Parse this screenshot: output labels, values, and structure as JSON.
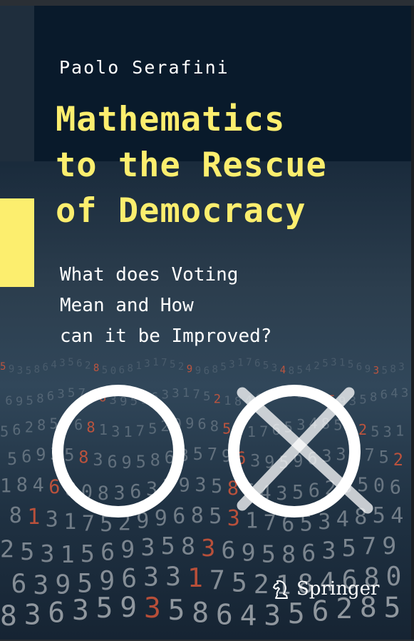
{
  "cover": {
    "author": "Paolo Serafini",
    "title_lines": [
      "Mathematics",
      "to the Rescue",
      "of Democracy"
    ],
    "subtitle_lines": [
      "What does Voting",
      "Mean and How",
      "can it be Improved?"
    ],
    "publisher": "Springer",
    "publisher_logo_icon": "springer-knight-icon",
    "ballot_symbols": [
      "circle-symbol",
      "crossed-circle-symbol"
    ],
    "background_digits": "5 9 3 5 8 6 4 3 5 6 2 8 5 0 6 8 1 3 1 7 5 2 9 9 6 8 5 3 1 7 6 5 3 4 8 5 4 2 5 3 1 5 6 9 3 5 8 3 6 9 5 8 6 3 5 7 9 6 3 9 5 9 6 3 3 1 7 5 2 1 8 4 6 8 0 8 3 6 3",
    "colors": {
      "title_yellow": "#fcee6e",
      "top_band": "#091a2b",
      "accent_bar": "#fcee6e",
      "digit_orange": "#e0593a",
      "digit_white": "#ffffff"
    }
  }
}
